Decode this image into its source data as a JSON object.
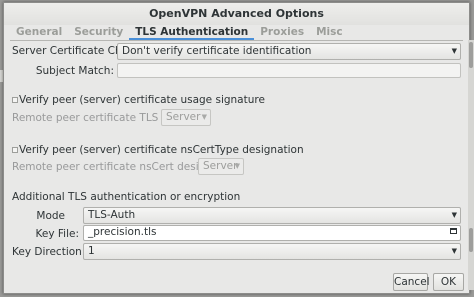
{
  "window": {
    "title": "OpenVPN Advanced Options"
  },
  "tabs": [
    {
      "label": "General",
      "active": false
    },
    {
      "label": "Security",
      "active": false
    },
    {
      "label": "TLS Authentication",
      "active": true
    },
    {
      "label": "Proxies",
      "active": false
    },
    {
      "label": "Misc",
      "active": false
    }
  ],
  "server_cert_check": {
    "label": "Server Certificate Check:",
    "value": "Don't verify certificate identification"
  },
  "subject_match": {
    "label": "Subject Match:",
    "value": ""
  },
  "verify_usage": {
    "checkbox_label": "Verify peer (server) certificate usage signature",
    "checked": false,
    "tls_type_label": "Remote peer certificate TLS type:",
    "tls_type_value": "Server"
  },
  "verify_nscert": {
    "checkbox_label": "Verify peer (server) certificate nsCertType designation",
    "checked": false,
    "nscert_label": "Remote peer certificate nsCert designation:",
    "nscert_value": "Server"
  },
  "additional_tls": {
    "heading": "Additional TLS authentication or encryption",
    "mode_label": "Mode",
    "mode_value": "TLS-Auth",
    "key_file_label": "Key File:",
    "key_file_value": "_precision.tls",
    "key_direction_label": "Key Direction:",
    "key_direction_value": "1"
  },
  "buttons": {
    "cancel": "Cancel",
    "ok": "OK"
  },
  "icons": {
    "dropdown": "chevron-down-icon",
    "file": "file-chooser-icon"
  },
  "colors": {
    "accent": "#4a90d9"
  }
}
